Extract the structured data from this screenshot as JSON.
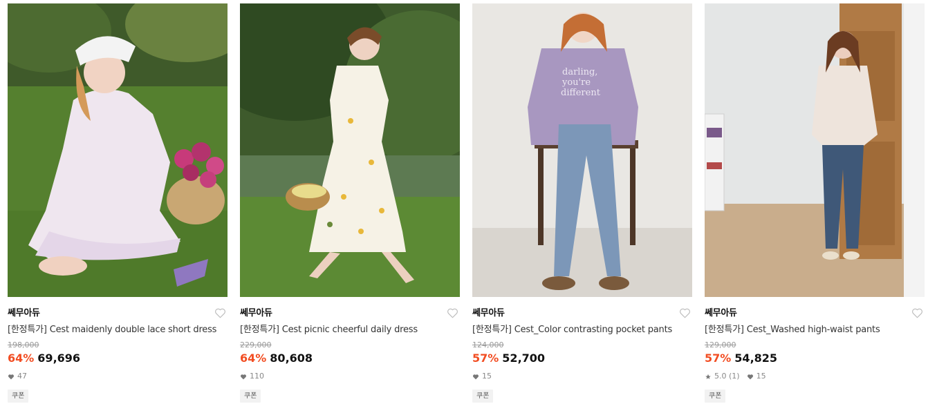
{
  "products": [
    {
      "brand": "쎄무아듀",
      "name": "[한정특가] Cest maidenly double lace short dress",
      "original_price": "198,000",
      "discount": "64%",
      "price": "69,696",
      "likes": "47",
      "coupon": "쿠폰",
      "image_desc": "woman in floral frill dress sitting on grass with basket of roses"
    },
    {
      "brand": "쎄무아듀",
      "name": "[한정특가] Cest picnic cheerful daily dress",
      "original_price": "229,000",
      "discount": "64%",
      "price": "80,608",
      "likes": "110",
      "coupon": "쿠폰",
      "image_desc": "woman in white floral midi dress walking on grass with basket"
    },
    {
      "brand": "쎄무아듀",
      "name": "[한정특가] Cest_Color contrasting pocket pants",
      "original_price": "124,000",
      "discount": "57%",
      "price": "52,700",
      "likes": "15",
      "coupon": "쿠폰",
      "image_desc": "woman in lavender knit and jeans leaning on wooden table"
    },
    {
      "brand": "쎄무아듀",
      "name": "[한정특가] Cest_Washed high-waist pants",
      "original_price": "129,000",
      "discount": "57%",
      "price": "54,825",
      "rating": "5.0 (1)",
      "likes": "15",
      "coupon": "쿠폰",
      "image_desc": "woman in floral blouse and jeans standing by wooden door"
    }
  ],
  "colors": {
    "discount": "#f24d22",
    "text": "#111111",
    "muted": "#999999"
  },
  "icons": {
    "wishlist": "heart-outline-icon",
    "likes": "heart-filled-icon",
    "rating": "star-icon"
  }
}
